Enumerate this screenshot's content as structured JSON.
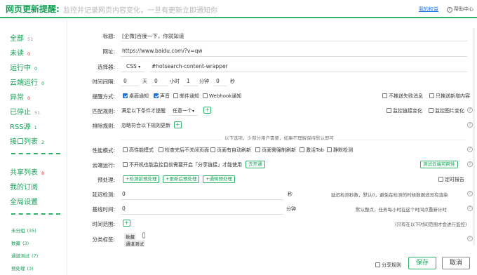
{
  "header": {
    "title": "网页更新提醒:",
    "subtitle": "监控并记录网页内容变化，一旦有更新立即通知你",
    "my_rights": "我的权益",
    "help": "帮助中心"
  },
  "sidebar": {
    "items": [
      {
        "label": "全部",
        "count": "51"
      },
      {
        "label": "未读",
        "count": "0"
      },
      {
        "label": "运行中",
        "count": "0"
      },
      {
        "label": "云端运行",
        "count": "0"
      },
      {
        "label": "异常",
        "count": "0"
      },
      {
        "label": "已停止",
        "count": "51"
      },
      {
        "label": "RSS源",
        "count": "1"
      },
      {
        "label": "接口列表",
        "count": "2"
      },
      {
        "label": "共享列表",
        "count": "8"
      },
      {
        "label": "我的订阅",
        "count": ""
      },
      {
        "label": "全局设置",
        "count": ""
      }
    ],
    "groups": [
      {
        "label": "未分组",
        "count": "(35)"
      },
      {
        "label": "数藏",
        "count": "(3)"
      },
      {
        "label": "通道测试",
        "count": "(7)"
      },
      {
        "label": "预处理",
        "count": "(3)"
      }
    ]
  },
  "form": {
    "title_label": "标题:",
    "title_value": "[企微]百度一下，你就知道",
    "url_label": "网址:",
    "url_value": "https://www.baidu.com/?v=qw",
    "selector_label": "选择器:",
    "selector_type": "CSS",
    "selector_value": "#hotsearch-content-wrapper",
    "interval_label": "时间间隔:",
    "interval_days": "0",
    "interval_days_unit": "天",
    "interval_hours": "0",
    "interval_hours_unit": "小时",
    "interval_minutes": "1",
    "interval_minutes_unit": "分钟",
    "interval_seconds": "0",
    "interval_seconds_unit": "秒",
    "notify_label": "提醒方式:",
    "notify_desktop": "桌面通知",
    "notify_sound": "声音",
    "notify_email": "邮件通知",
    "notify_webhook": "Webhook通知",
    "notify_no_fail": "不推送失败消息",
    "notify_new_only": "只推送新增内容",
    "match_label": "匹配规则:",
    "match_text": "满足以下条件才提醒",
    "match_any": "任意一个",
    "match_link": "监控链接变化",
    "match_image": "监控图片变化",
    "exclude_label": "排除规则:",
    "exclude_text": "忽略符合以下规则更新",
    "advanced_hint": "以下选项，少部分用户需要，如果不理解保持默认即可",
    "perf_label": "性能模式:",
    "perf_opts": [
      "高性能模式",
      "检查完后不关闭页面",
      "页面有自动刷新",
      "页面需强制刷新",
      "激活Tab",
      "静默检测"
    ],
    "cloud_label": "云端运行:",
    "cloud_text": "不开机也能监控目前需要开启「分享链接」才能使用",
    "cloud_open": "去开通",
    "cloud_test": "测试云端可用性",
    "pre_label": "预处理:",
    "pre_btn1": "+检测前预处理",
    "pre_btn2": "+更新后预处理",
    "pre_btn3": "+通知预处理",
    "pre_report": "定时报告",
    "delay_label": "延迟检测:",
    "delay_value": "0",
    "delay_unit": "秒",
    "delay_note": "延迟检测秒数，默认0，避免在检测的时候数据还没有渲染",
    "base_label": "基线时间:",
    "base_value": "0",
    "base_unit": "分钟",
    "base_note": "默认整点，任务每小时在这个时间点重新计时",
    "range_label": "时间范围:",
    "range_note": "(只有在以下时间范围才会进行监控)",
    "tags_label": "分类标签:",
    "tag1": "数藏",
    "tag2": "通道测试",
    "share_rule": "分享规则",
    "save": "保存",
    "cancel": "取消"
  }
}
